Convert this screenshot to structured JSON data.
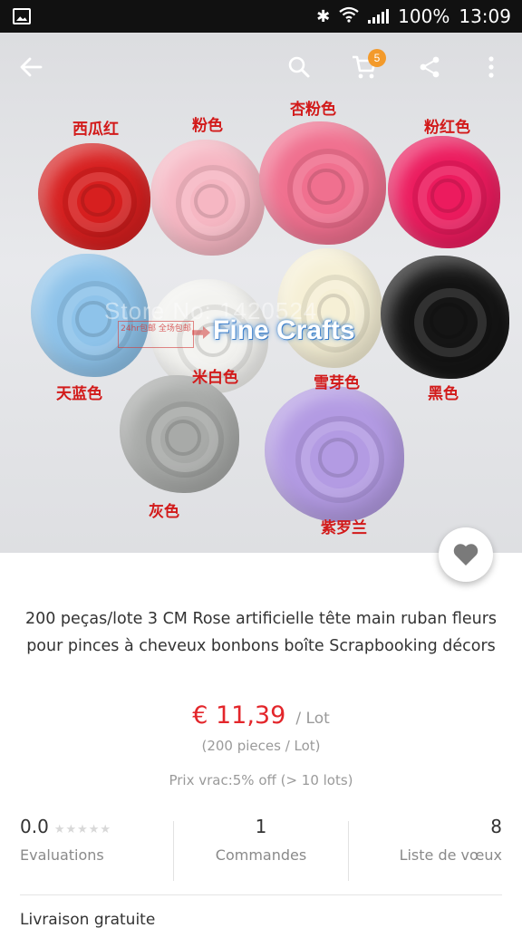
{
  "status_bar": {
    "battery": "100%",
    "time": "13:09"
  },
  "app_bar": {
    "cart_badge": "5"
  },
  "product_image": {
    "roses": [
      {
        "label": "西瓜红",
        "color": "#d71f1f"
      },
      {
        "label": "粉色",
        "color": "#f6b7c3"
      },
      {
        "label": "杏粉色",
        "color": "#f0708f"
      },
      {
        "label": "粉红色",
        "color": "#ec1b5e"
      },
      {
        "label": "天蓝色",
        "color": "#8ec3ea"
      },
      {
        "label": "米白色",
        "color": "#f3f3f0"
      },
      {
        "label": "雪芽色",
        "color": "#f6f0d6"
      },
      {
        "label": "黑色",
        "color": "#151515"
      },
      {
        "label": "灰色",
        "color": "#a8aaa8"
      },
      {
        "label": "紫罗兰",
        "color": "#b39be3"
      }
    ],
    "watermark": "Fine Crafts",
    "watermark_faint": "Store No: 1420524",
    "watermark_box": "24hr包邮 全场包邮"
  },
  "product": {
    "title": "200 peças/lote 3 CM Rose artificielle tête main ruban fleurs pour pinces à cheveux bonbons boîte Scrapbooking décors",
    "price": "€ 11,39",
    "price_unit": "/ Lot",
    "pieces": "(200 pieces / Lot)",
    "bulk_price": "Prix vrac:5% off (> 10 lots)"
  },
  "stats": {
    "rating": "0.0",
    "rating_label": "Evaluations",
    "orders": "1",
    "orders_label": "Commandes",
    "wishlist": "8",
    "wishlist_label": "Liste de vœux"
  },
  "shipping": {
    "label": "Livraison gratuite"
  },
  "colors": {
    "price": "#e3262b",
    "badge": "#f39a2b"
  }
}
